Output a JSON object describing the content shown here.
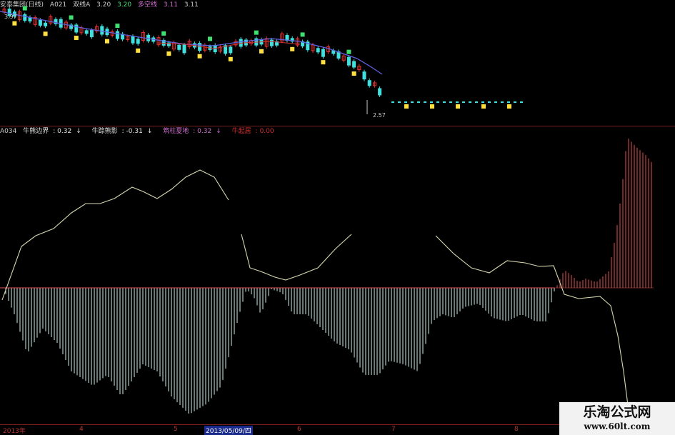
{
  "top_header": {
    "stock_name": "安泰集团(日线)",
    "indicator": "A021",
    "item1_label": "双线A",
    "item1_value": "3.20",
    "item1_value2": "3.20",
    "item2_label": "多空线",
    "item2_value": "3.11",
    "item3_value": "3.11",
    "high_label": "3.97",
    "low_label": "2.57"
  },
  "indicator_header": {
    "name": "A034",
    "items": [
      {
        "label": "牛熊边界",
        "value": "0.32",
        "arrow": "↓",
        "color": "#e6e6e6"
      },
      {
        "label": "牛踪熊影",
        "value": "-0.31",
        "arrow": "↓",
        "color": "#e6e6e6"
      },
      {
        "label": "筑柱夏地",
        "value": "0.32",
        "arrow": "↓",
        "color": "#d070d0"
      },
      {
        "label": "牛起居",
        "value": "0.00",
        "arrow": "",
        "color": "#d03030"
      }
    ]
  },
  "x_axis": {
    "labels": [
      {
        "text": "2013年"
      },
      {
        "text": "4"
      },
      {
        "text": "5"
      },
      {
        "text": "2013/05/09/四",
        "highlight": true
      },
      {
        "text": "6"
      },
      {
        "text": "7"
      },
      {
        "text": "8"
      }
    ]
  },
  "watermark": {
    "title": "乐淘公式网",
    "url": "www.60lt.com"
  },
  "colors": {
    "background": "#000000",
    "candle_up": "#e03030",
    "candle_down": "#40e0e0",
    "ma_line": "#6060e0",
    "ma_line2": "#d03030",
    "osc_line": "#d8d8b0",
    "bar_negative": "#d0f0e8",
    "bar_positive": "#e05050",
    "zero_line": "#e05050",
    "signal_yellow": "#ffe040",
    "signal_green": "#40e070"
  }
}
